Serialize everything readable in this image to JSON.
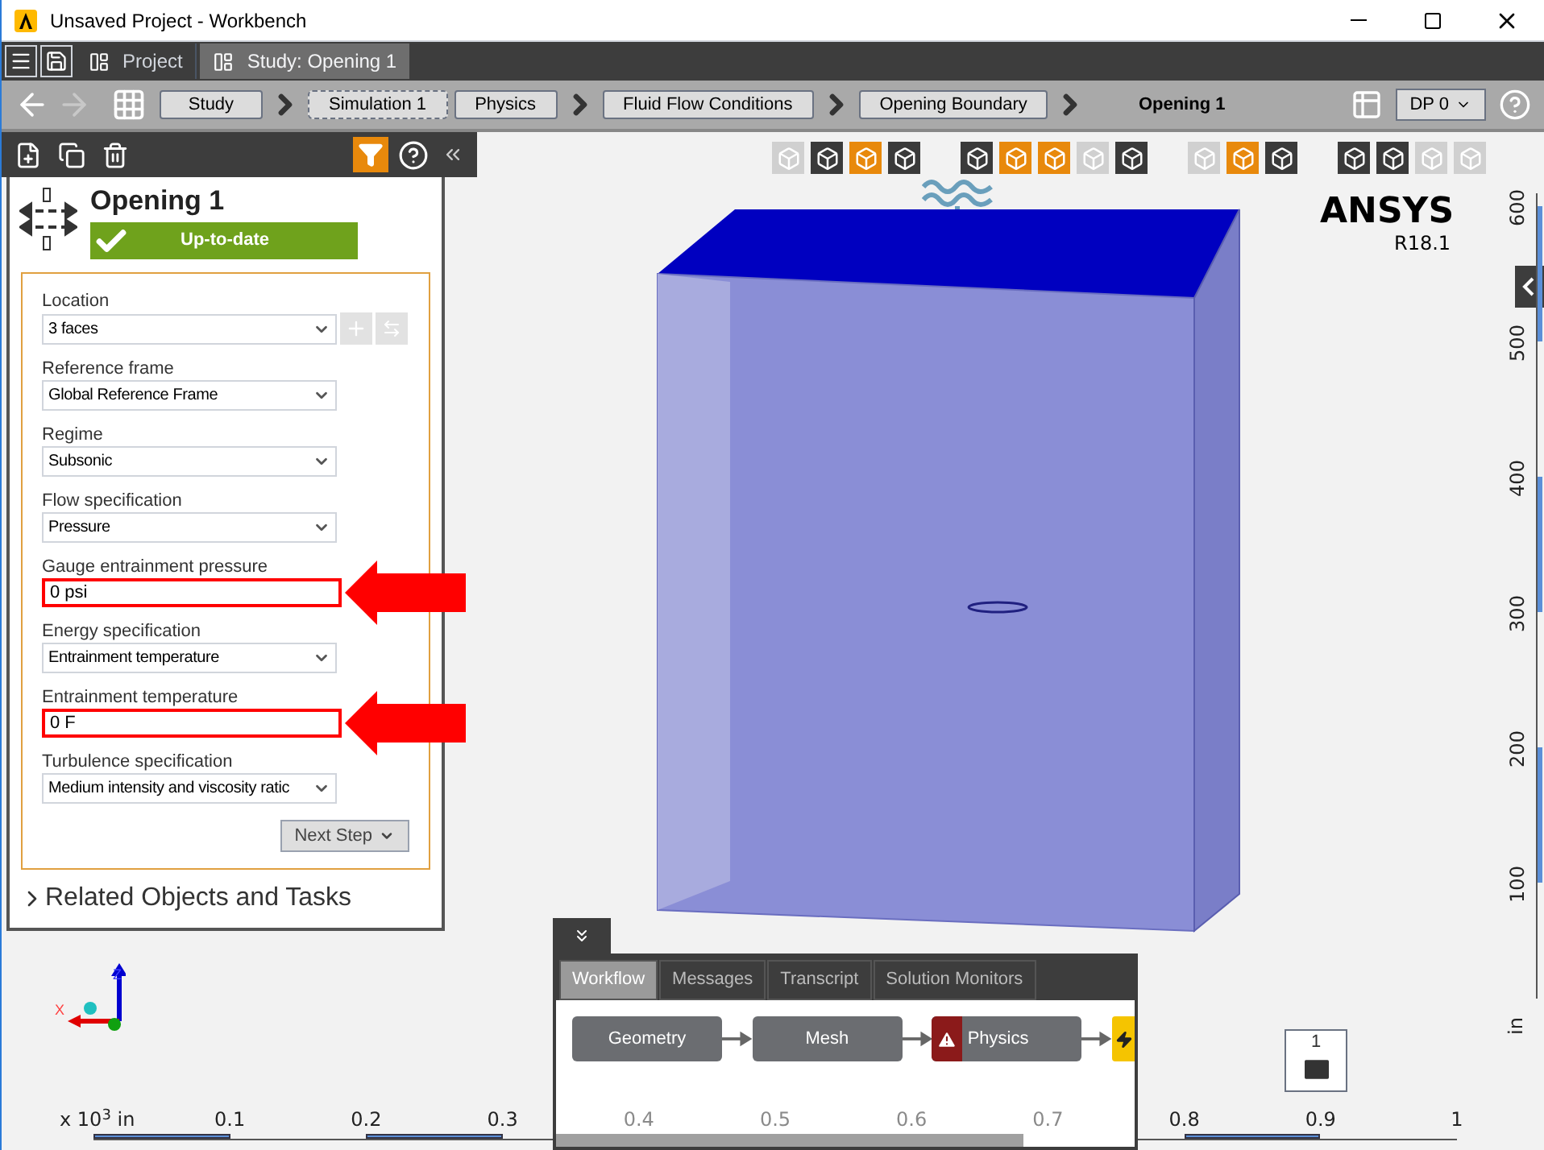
{
  "window": {
    "title": "Unsaved Project - Workbench"
  },
  "app_tabs": [
    {
      "label": "Project",
      "selected": false
    },
    {
      "label": "Study: Opening 1",
      "selected": true
    }
  ],
  "breadcrumb": [
    {
      "label": "Study",
      "kind": "step",
      "chevron_after": true
    },
    {
      "label": "Simulation 1",
      "kind": "dashed",
      "chevron_after": false
    },
    {
      "label": "Physics",
      "kind": "step",
      "chevron_after": true
    },
    {
      "label": "Fluid Flow Conditions",
      "kind": "step",
      "chevron_after": true
    },
    {
      "label": "Opening Boundary",
      "kind": "step",
      "chevron_after": true
    },
    {
      "label": "Opening 1",
      "kind": "current",
      "chevron_after": false
    }
  ],
  "design_point": {
    "label": "DP 0"
  },
  "panel": {
    "title": "Opening 1",
    "status": "Up-to-date",
    "fields": [
      {
        "label": "Location",
        "value": "3 faces",
        "kind": "location",
        "highlighted": false
      },
      {
        "label": "Reference frame",
        "value": "Global Reference Frame",
        "kind": "select",
        "highlighted": false
      },
      {
        "label": "Regime",
        "value": "Subsonic",
        "kind": "select",
        "highlighted": false
      },
      {
        "label": "Flow specification",
        "value": "Pressure",
        "kind": "select",
        "highlighted": false
      },
      {
        "label": "Gauge entrainment pressure",
        "value": "0 psi",
        "kind": "input",
        "highlighted": true
      },
      {
        "label": "Energy specification",
        "value": "Entrainment temperature",
        "kind": "select",
        "highlighted": false
      },
      {
        "label": "Entrainment temperature",
        "value": "0 F",
        "kind": "input",
        "highlighted": true
      },
      {
        "label": "Turbulence specification",
        "value": "Medium intensity and viscosity ratic",
        "kind": "select",
        "highlighted": false
      }
    ],
    "next_button": "Next Step",
    "related": "Related Objects and Tasks"
  },
  "viewport": {
    "toolbar_groups": [
      [
        {
          "active": false,
          "disabled": true
        },
        {
          "active": false,
          "disabled": false
        },
        {
          "active": true,
          "disabled": false
        },
        {
          "active": false,
          "disabled": false
        }
      ],
      [
        {
          "active": false,
          "disabled": false
        },
        {
          "active": true,
          "disabled": false
        },
        {
          "active": true,
          "disabled": false
        },
        {
          "active": false,
          "disabled": true
        },
        {
          "active": false,
          "disabled": false
        }
      ],
      [
        {
          "active": false,
          "disabled": true
        },
        {
          "active": true,
          "disabled": false
        },
        {
          "active": false,
          "disabled": false
        }
      ],
      [
        {
          "active": false,
          "disabled": false
        },
        {
          "active": false,
          "disabled": false
        },
        {
          "active": false,
          "disabled": true
        },
        {
          "active": false,
          "disabled": true
        }
      ]
    ],
    "logo": "ANSYS",
    "version": "R18.1",
    "axis_labels": [
      "Z",
      "X"
    ],
    "x_ruler": {
      "unit": "x 10$^{3}$ in",
      "labels": [
        "0.1",
        "0.2",
        "0.3",
        "0.4",
        "0.5",
        "0.6",
        "0.7",
        "0.8",
        "0.9",
        "1"
      ]
    },
    "y_ruler": {
      "unit": "in",
      "labels": [
        "600",
        "500",
        "400",
        "300",
        "200",
        "100"
      ]
    },
    "message_count": "1"
  },
  "dock": {
    "tabs": [
      {
        "label": "Workflow",
        "selected": true
      },
      {
        "label": "Messages",
        "selected": false
      },
      {
        "label": "Transcript",
        "selected": false
      },
      {
        "label": "Solution Monitors",
        "selected": false
      }
    ],
    "nodes": [
      {
        "label": "Geometry",
        "kind": "normal"
      },
      {
        "label": "Mesh",
        "kind": "normal"
      },
      {
        "label": "Physics",
        "kind": "warning"
      },
      {
        "kind": "action"
      }
    ]
  }
}
